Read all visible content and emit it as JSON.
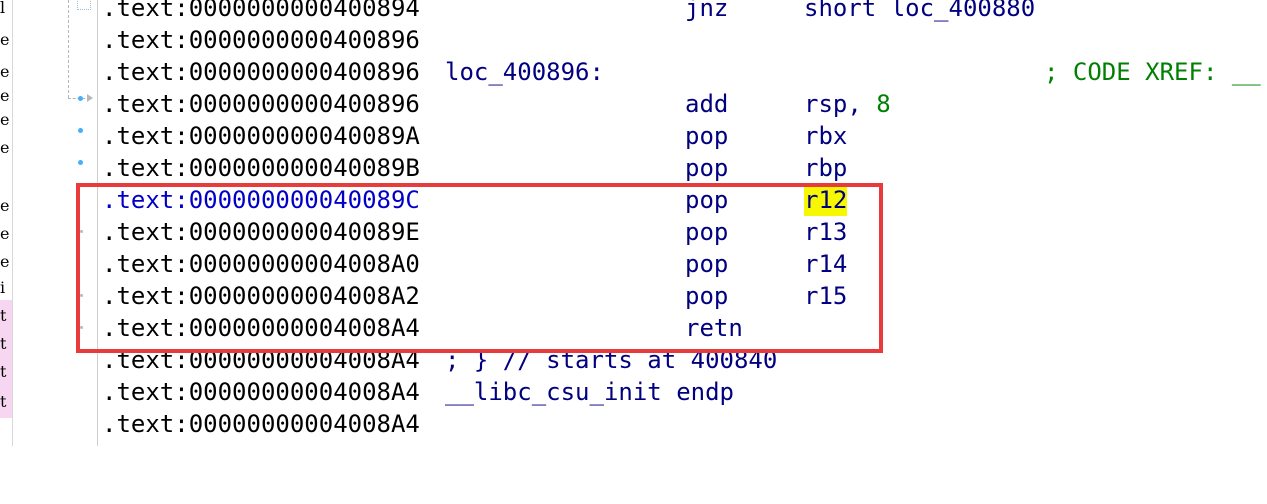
{
  "colors": {
    "highlight": "#f7f700",
    "annotation_box": "#e83b3b",
    "address_selected": "#0000c8",
    "keyword": "#000080",
    "comment": "#008000"
  },
  "left_strip": [
    "l",
    "e",
    "e",
    "e",
    "e",
    "e",
    "e",
    "e",
    "e",
    "i",
    "t",
    "t",
    "t",
    "t"
  ],
  "lines": [
    {
      "addr": ".text:0000000000400894",
      "label": "",
      "mnem": "jnz",
      "op": "short loc_400880",
      "xref": ""
    },
    {
      "addr": ".text:0000000000400896",
      "label": "",
      "mnem": "",
      "op": "",
      "xref": ""
    },
    {
      "addr": ".text:0000000000400896",
      "label": "loc_400896:",
      "mnem": "",
      "op": "",
      "xref": "; CODE XREF: __"
    },
    {
      "addr": ".text:0000000000400896",
      "label": "",
      "mnem": "add",
      "op": "rsp, ",
      "op_num": "8",
      "xref": ""
    },
    {
      "addr": ".text:000000000040089A",
      "label": "",
      "mnem": "pop",
      "op": "rbx",
      "xref": ""
    },
    {
      "addr": ".text:000000000040089B",
      "label": "",
      "mnem": "pop",
      "op": "rbp",
      "xref": ""
    },
    {
      "addr": ".text:000000000040089C",
      "label": "",
      "mnem": "pop",
      "op": "r12",
      "xref": ""
    },
    {
      "addr": ".text:000000000040089E",
      "label": "",
      "mnem": "pop",
      "op": "r13",
      "xref": ""
    },
    {
      "addr": ".text:00000000004008A0",
      "label": "",
      "mnem": "pop",
      "op": "r14",
      "xref": ""
    },
    {
      "addr": ".text:00000000004008A2",
      "label": "",
      "mnem": "pop",
      "op": "r15",
      "xref": ""
    },
    {
      "addr": ".text:00000000004008A4",
      "label": "",
      "mnem": "retn",
      "op": "",
      "xref": ""
    },
    {
      "addr": ".text:00000000004008A4",
      "label": "; } // starts at 400840",
      "mnem": "",
      "op": "",
      "xref": ""
    },
    {
      "addr": ".text:00000000004008A4",
      "label": "__libc_csu_init endp",
      "mnem": "",
      "op": "",
      "xref": ""
    },
    {
      "addr": ".text:00000000004008A4",
      "label": "",
      "mnem": "",
      "op": "",
      "xref": ""
    }
  ]
}
